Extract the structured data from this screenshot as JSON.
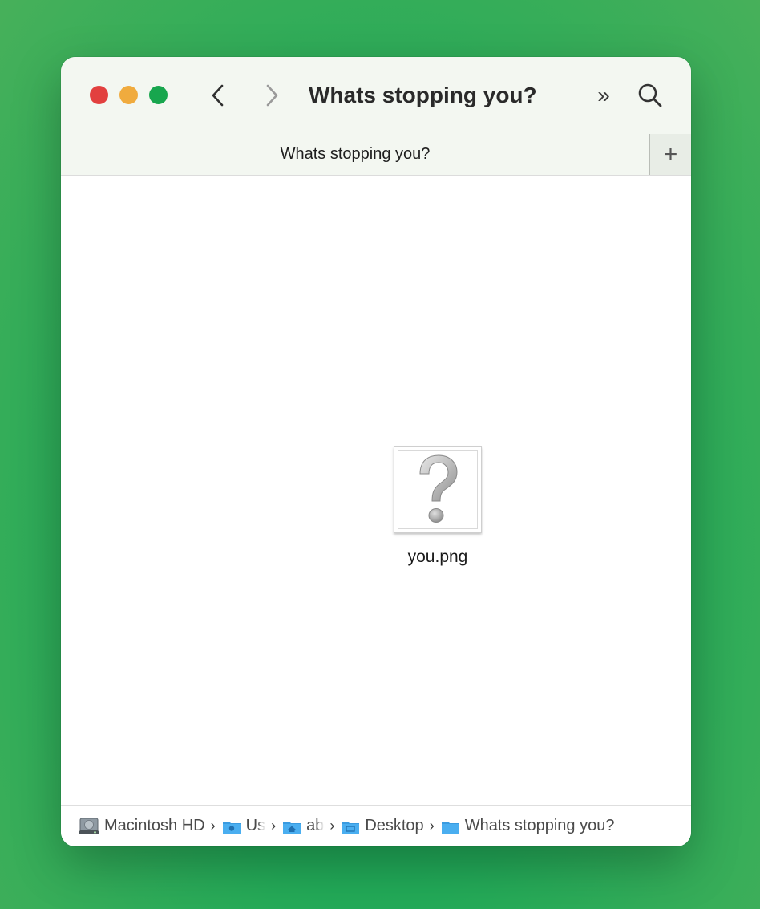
{
  "window": {
    "title": "Whats stopping you?",
    "more_glyph": "»",
    "icons": {
      "back": "chevron-left-icon",
      "forward": "chevron-right-icon",
      "search": "magnifier-icon"
    }
  },
  "tabs": {
    "items": [
      {
        "label": "Whats stopping you?",
        "active": true
      }
    ],
    "add_glyph": "+"
  },
  "content": {
    "files": [
      {
        "name": "you.png",
        "icon": "question-mark-icon"
      }
    ]
  },
  "path_bar": {
    "items": [
      {
        "label": "Macintosh HD",
        "icon": "hard-drive-icon"
      },
      {
        "label": "Us",
        "icon": "users-folder-icon"
      },
      {
        "label": "ab",
        "icon": "home-folder-icon"
      },
      {
        "label": "Desktop",
        "icon": "desktop-folder-icon"
      },
      {
        "label": "Whats stopping you?",
        "icon": "folder-icon"
      }
    ],
    "separator": "›"
  },
  "colors": {
    "background": "#22aa58",
    "close": "#e2403f",
    "minimize": "#f0ab3e",
    "zoom": "#18a64e",
    "folder_blue": "#3a9be0"
  }
}
